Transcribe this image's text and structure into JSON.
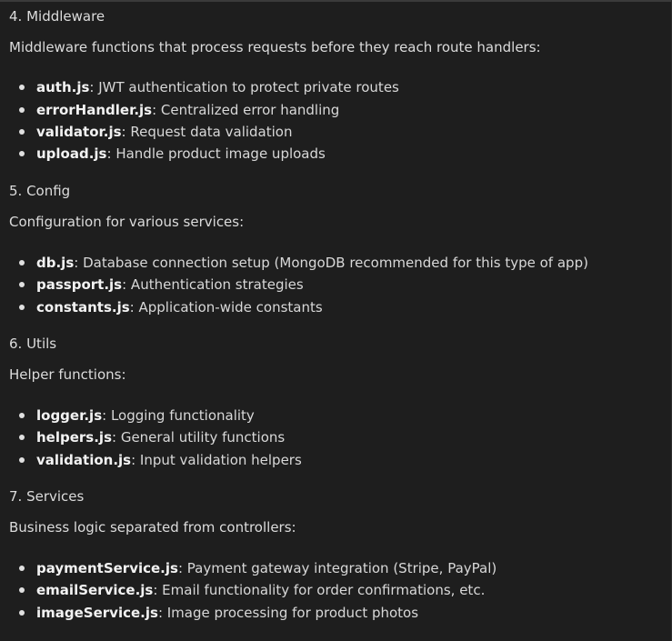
{
  "sections": [
    {
      "heading": "4. Middleware",
      "intro": "Middleware functions that process requests before they reach route handlers:",
      "items": [
        {
          "name": "auth.js",
          "desc": ": JWT authentication to protect private routes"
        },
        {
          "name": "errorHandler.js",
          "desc": ": Centralized error handling"
        },
        {
          "name": "validator.js",
          "desc": ": Request data validation"
        },
        {
          "name": "upload.js",
          "desc": ": Handle product image uploads"
        }
      ]
    },
    {
      "heading": "5. Config",
      "intro": "Configuration for various services:",
      "items": [
        {
          "name": "db.js",
          "desc": ": Database connection setup (MongoDB recommended for this type of app)"
        },
        {
          "name": "passport.js",
          "desc": ": Authentication strategies"
        },
        {
          "name": "constants.js",
          "desc": ": Application-wide constants"
        }
      ]
    },
    {
      "heading": "6. Utils",
      "intro": "Helper functions:",
      "items": [
        {
          "name": "logger.js",
          "desc": ": Logging functionality"
        },
        {
          "name": "helpers.js",
          "desc": ": General utility functions"
        },
        {
          "name": "validation.js",
          "desc": ": Input validation helpers"
        }
      ]
    },
    {
      "heading": "7. Services",
      "intro": "Business logic separated from controllers:",
      "items": [
        {
          "name": "paymentService.js",
          "desc": ": Payment gateway integration (Stripe, PayPal)"
        },
        {
          "name": "emailService.js",
          "desc": ": Email functionality for order confirmations, etc."
        },
        {
          "name": "imageService.js",
          "desc": ": Image processing for product photos"
        }
      ]
    }
  ]
}
